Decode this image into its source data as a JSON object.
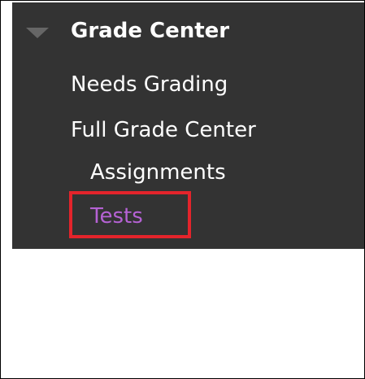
{
  "nav": {
    "section_title": "Grade Center",
    "items": [
      {
        "label": "Needs Grading"
      },
      {
        "label": "Full Grade Center"
      },
      {
        "label": "Assignments"
      },
      {
        "label": "Tests",
        "active": true
      }
    ],
    "collapse_icon": "triangle-down-icon"
  },
  "colors": {
    "panel_background": "#333333",
    "text": "#ffffff",
    "active_item": "#b562d4",
    "highlight_box": "#e4242b",
    "caret": "#666666"
  }
}
